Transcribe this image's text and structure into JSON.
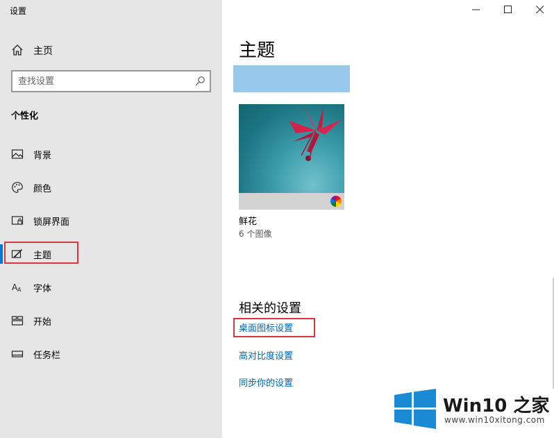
{
  "window": {
    "title": "设置"
  },
  "sidebar": {
    "home_label": "主页",
    "search_placeholder": "查找设置",
    "section_title": "个性化",
    "items": [
      {
        "label": "背景",
        "icon": "picture-icon"
      },
      {
        "label": "颜色",
        "icon": "palette-icon"
      },
      {
        "label": "锁屏界面",
        "icon": "lock-screen-icon"
      },
      {
        "label": "主题",
        "icon": "theme-brush-icon",
        "selected": true
      },
      {
        "label": "字体",
        "icon": "font-icon"
      },
      {
        "label": "开始",
        "icon": "start-icon"
      },
      {
        "label": "任务栏",
        "icon": "taskbar-icon"
      }
    ]
  },
  "main": {
    "page_title": "主题",
    "accent_color": "#99c9ea",
    "theme": {
      "name": "鲜花",
      "count": "6 个图像"
    },
    "related_title": "相关的设置",
    "links": [
      "桌面图标设置",
      "高对比度设置",
      "同步你的设置"
    ]
  },
  "watermark": {
    "brand": "Win10",
    "brand_zh": "之家",
    "url": "www.win10xitong.com"
  },
  "colors": {
    "highlight": "#d9363e",
    "link": "#0066b4",
    "selected_bar": "#0078d7",
    "sidebar_bg": "#e6e6e6"
  }
}
